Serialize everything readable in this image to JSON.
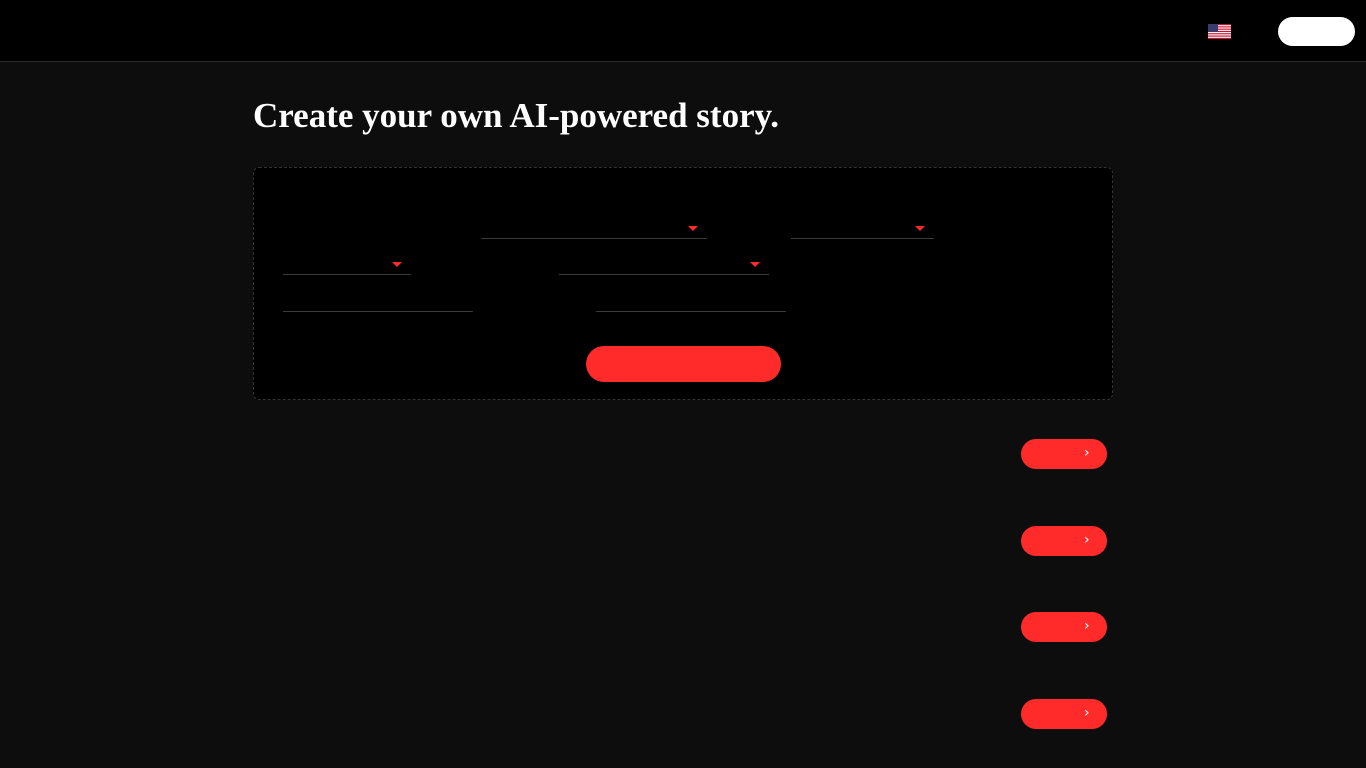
{
  "header": {
    "language_flag_icon": "us-flag-icon",
    "account_button_label": ""
  },
  "page": {
    "title": "Create your own AI-powered story."
  },
  "form": {
    "selects": [
      {
        "value": "",
        "icon": "caret-down-icon"
      },
      {
        "value": "",
        "icon": "caret-down-icon"
      },
      {
        "value": "",
        "icon": "caret-down-icon"
      },
      {
        "value": "",
        "icon": "caret-down-icon"
      }
    ],
    "inputs": [
      {
        "value": "",
        "placeholder": ""
      },
      {
        "value": "",
        "placeholder": ""
      }
    ],
    "submit_label": ""
  },
  "story_actions": [
    {
      "label": "",
      "icon": "chevron-right-icon"
    },
    {
      "label": "",
      "icon": "chevron-right-icon"
    },
    {
      "label": "",
      "icon": "chevron-right-icon"
    },
    {
      "label": "",
      "icon": "chevron-right-icon"
    }
  ],
  "colors": {
    "accent": "#ff2b2b",
    "page_background": "#0d0d0d",
    "panel_background": "#000000",
    "text": "#ffffff"
  }
}
